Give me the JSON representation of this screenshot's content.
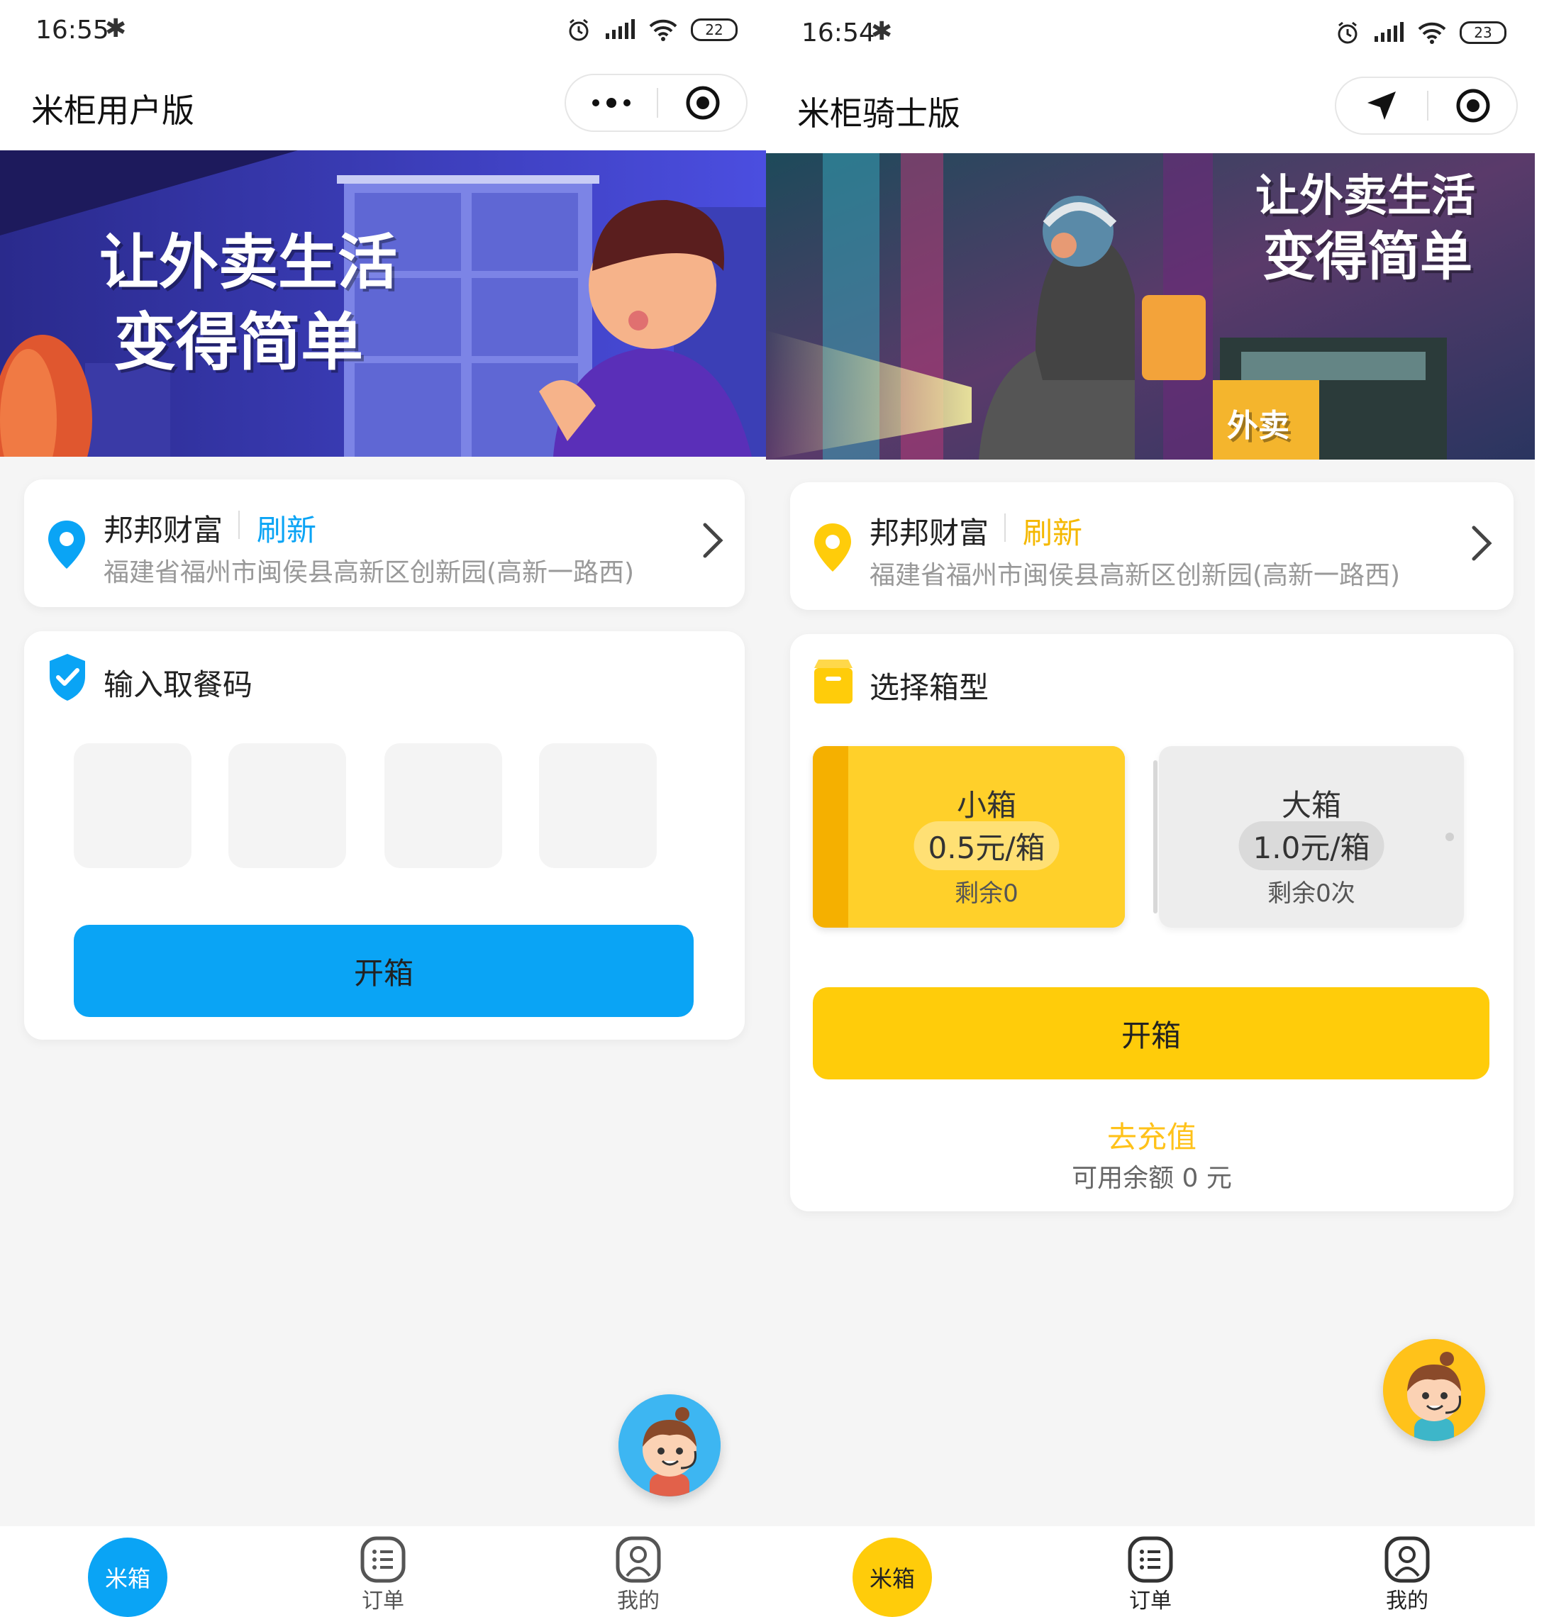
{
  "left": {
    "status": {
      "time": "16:55",
      "battery": "22"
    },
    "nav": {
      "title": "米柜用户版"
    },
    "banner": {
      "line1": "让外卖生活",
      "line2": "变得简单"
    },
    "location": {
      "name": "邦邦财富",
      "refresh": "刷新",
      "address": "福建省福州市闽侯县高新区创新园(高新一路西)"
    },
    "code_section": {
      "title": "输入取餐码",
      "open_button": "开箱"
    },
    "tabs": [
      {
        "label": "米箱"
      },
      {
        "label": "订单"
      },
      {
        "label": "我的"
      }
    ],
    "colors": {
      "accent": "#0aa4f5"
    }
  },
  "right": {
    "status": {
      "time": "16:54",
      "battery": "23"
    },
    "nav": {
      "title": "米柜骑士版"
    },
    "banner": {
      "line1": "让外卖生活",
      "line2": "变得简单",
      "box_label": "外卖"
    },
    "location": {
      "name": "邦邦财富",
      "refresh": "刷新",
      "address": "福建省福州市闽侯县高新区创新园(高新一路西)"
    },
    "box_section": {
      "title": "选择箱型",
      "boxes": [
        {
          "name": "小箱",
          "price": "0.5元/箱",
          "remaining": "剩余0",
          "selected": true
        },
        {
          "name": "大箱",
          "price": "1.0元/箱",
          "remaining": "剩余0次",
          "selected": false
        }
      ],
      "open_button": "开箱",
      "recharge": "去充值",
      "balance": "可用余额 0 元"
    },
    "tabs": [
      {
        "label": "米箱"
      },
      {
        "label": "订单"
      },
      {
        "label": "我的"
      }
    ],
    "colors": {
      "accent": "#ffcc0a"
    }
  }
}
